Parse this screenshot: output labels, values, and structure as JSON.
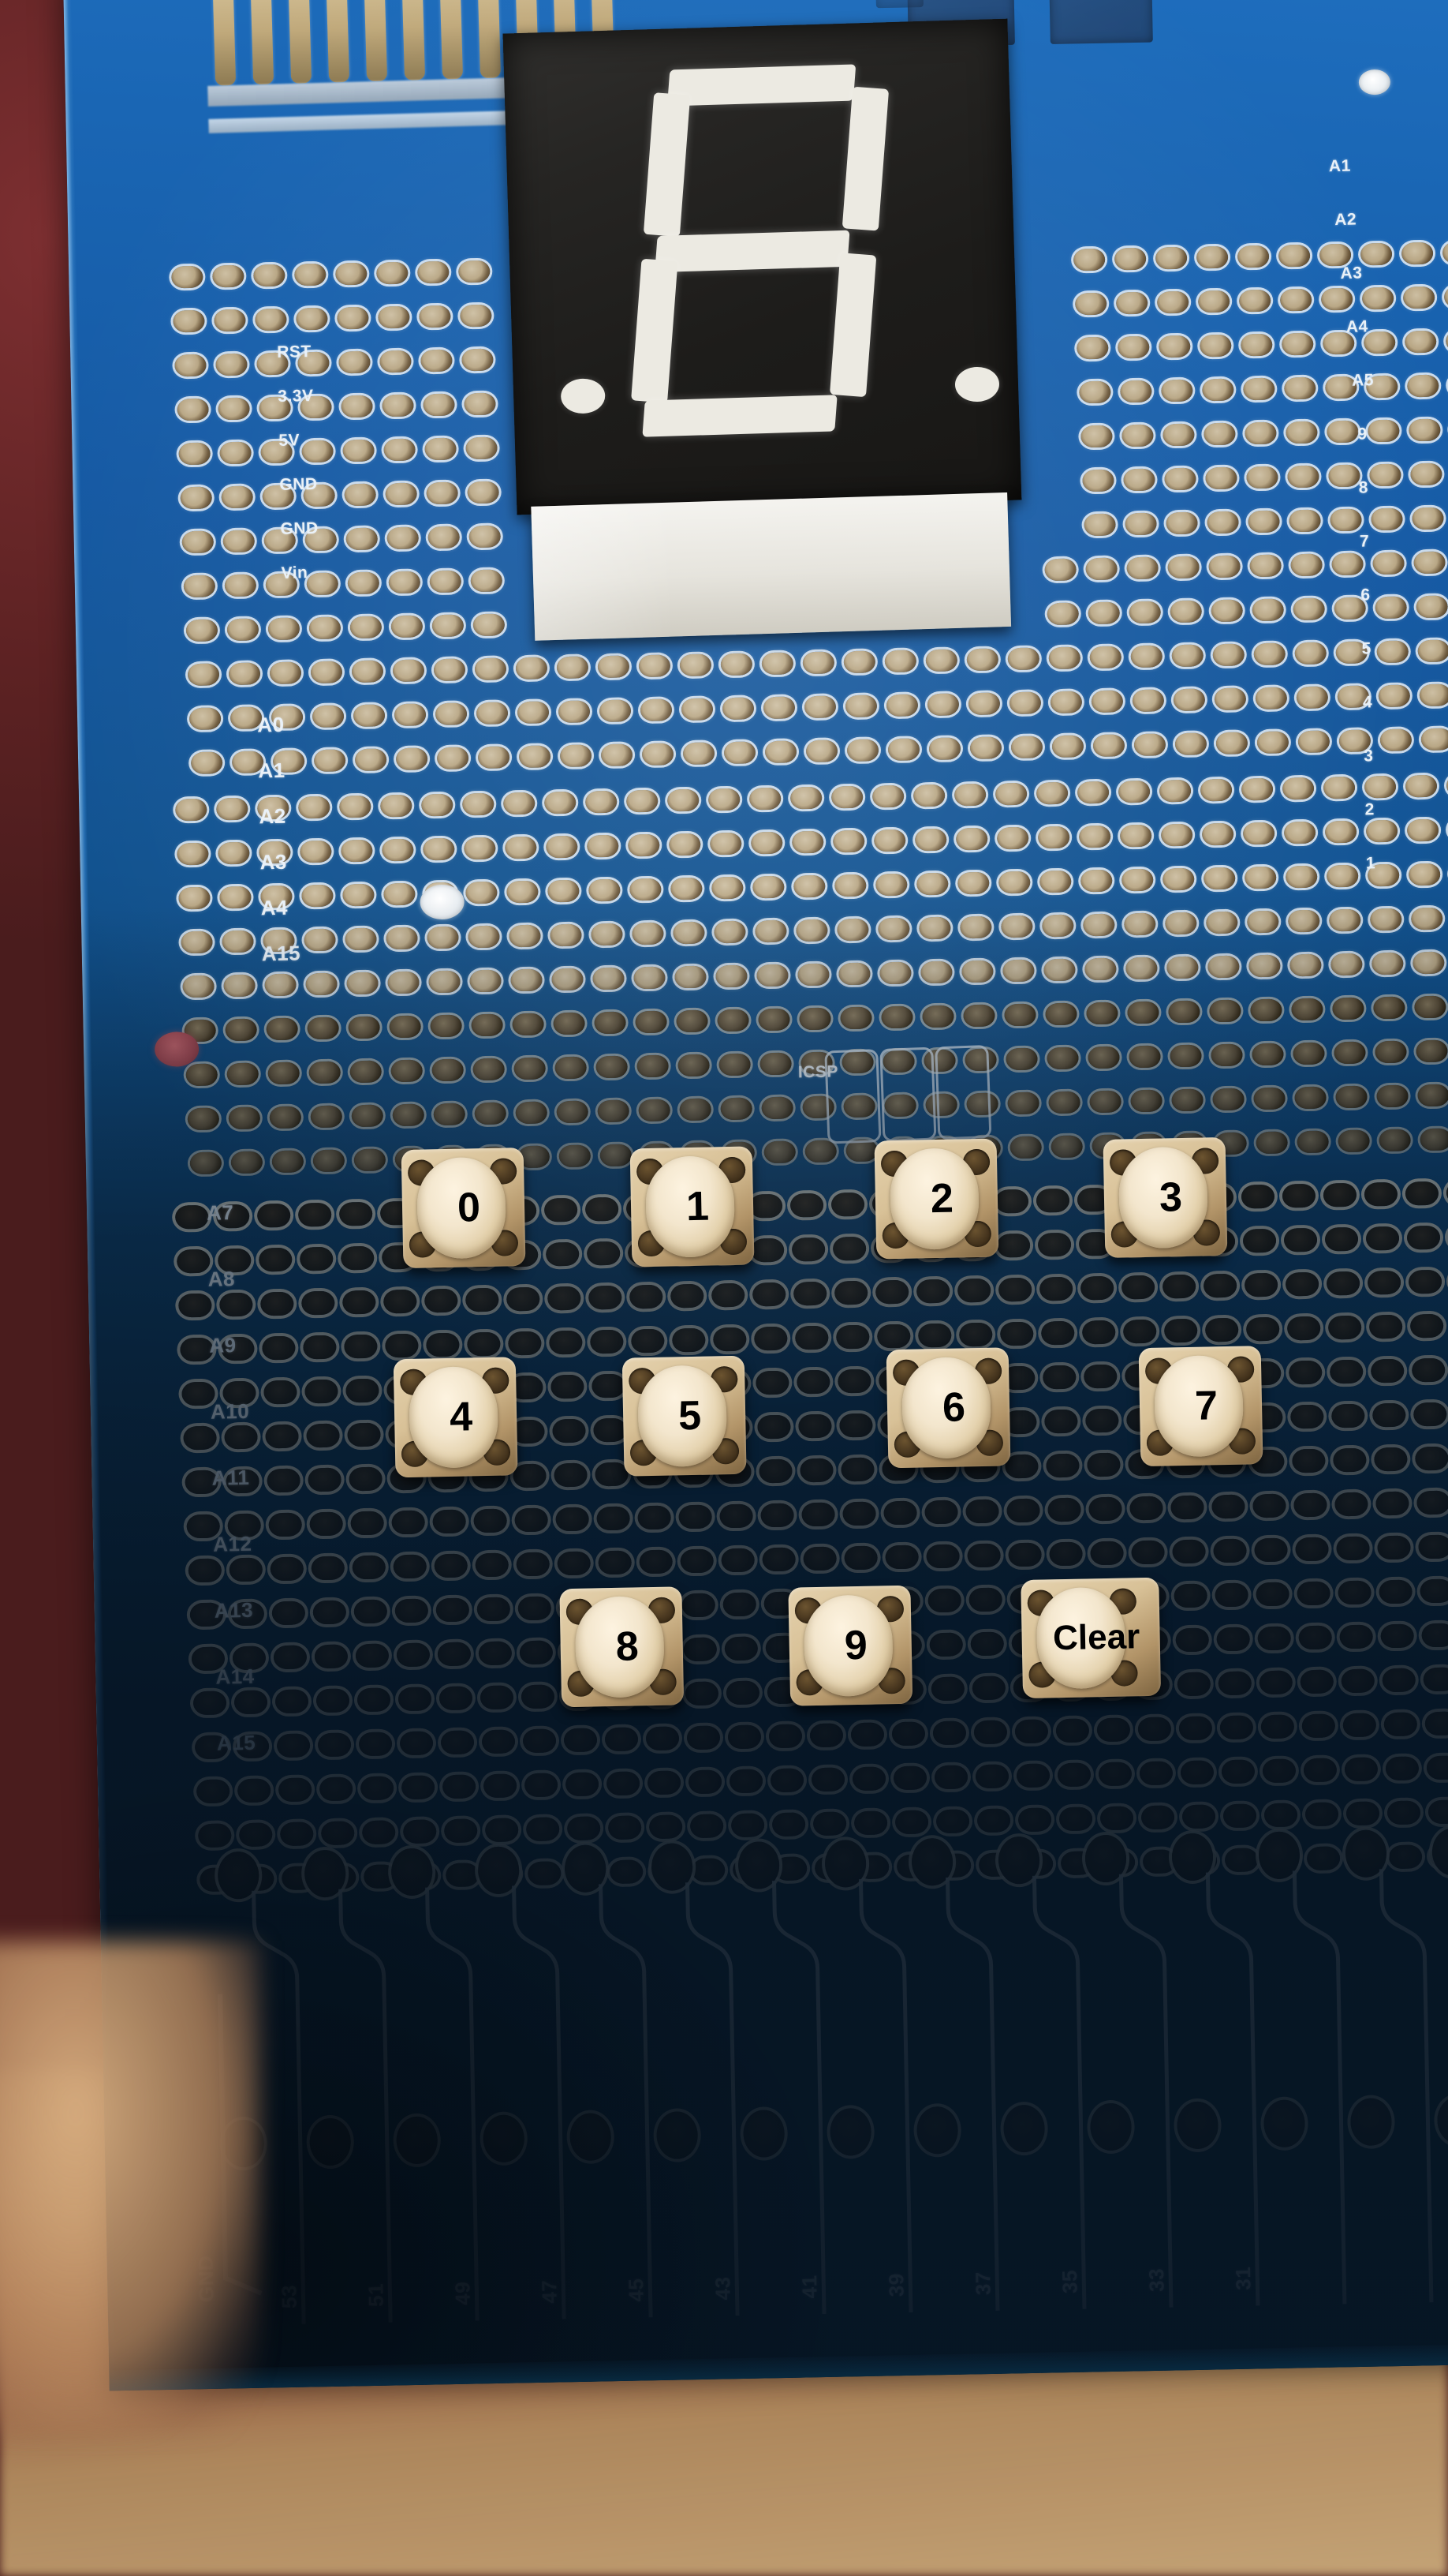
{
  "scene": {
    "subject": "arduino-mega-prototype-shield-keypad",
    "board_color": "#1559a3",
    "board_color_dark": "#0a2b45",
    "pad_color": "#b8a684",
    "silkscreen_color": "#e9f1f8",
    "background_color": "#6b2a2a"
  },
  "display": {
    "name": "seven-segment-display",
    "digit": "8",
    "segments": {
      "a": true,
      "b": true,
      "c": true,
      "d": true,
      "e": true,
      "f": true,
      "g": true
    },
    "decimal_points": 2,
    "face_color": "#1d1c1a",
    "lit_color": "#eceae2",
    "body_color": "#f4f3ef"
  },
  "keypad": {
    "label": "numeric-keypad",
    "rows": [
      [
        {
          "key": "0",
          "name": "key-0"
        },
        {
          "key": "1",
          "name": "key-1"
        },
        {
          "key": "2",
          "name": "key-2"
        },
        {
          "key": "3",
          "name": "key-3"
        }
      ],
      [
        {
          "key": "4",
          "name": "key-4"
        },
        {
          "key": "5",
          "name": "key-5"
        },
        {
          "key": "6",
          "name": "key-6"
        },
        {
          "key": "7",
          "name": "key-7"
        }
      ],
      [
        {
          "key": "8",
          "name": "key-8"
        },
        {
          "key": "9",
          "name": "key-9"
        },
        {
          "key": "Clear",
          "name": "key-clear"
        }
      ]
    ]
  },
  "silkscreen": {
    "power_header": [
      "RST",
      "3.3V",
      "5V",
      "GND",
      "GND",
      "Vin"
    ],
    "analog_left_upper": [
      "A0",
      "A1",
      "A2",
      "A3",
      "A4",
      "A15"
    ],
    "analog_left_lower": [
      "A7",
      "A8",
      "A9",
      "A10",
      "A11",
      "A12",
      "A13",
      "A14",
      "A15"
    ],
    "gnd_label": "GND",
    "icsp_label": "ICSP",
    "digital_bottom": [
      "53",
      "51",
      "49",
      "47",
      "45",
      "43",
      "41",
      "39",
      "37",
      "35",
      "33",
      "31"
    ],
    "right_edge": [
      "A1",
      "A2",
      "A3",
      "A4",
      "A5",
      "9",
      "8",
      "7",
      "6",
      "5",
      "4",
      "3",
      "2",
      "1"
    ]
  }
}
